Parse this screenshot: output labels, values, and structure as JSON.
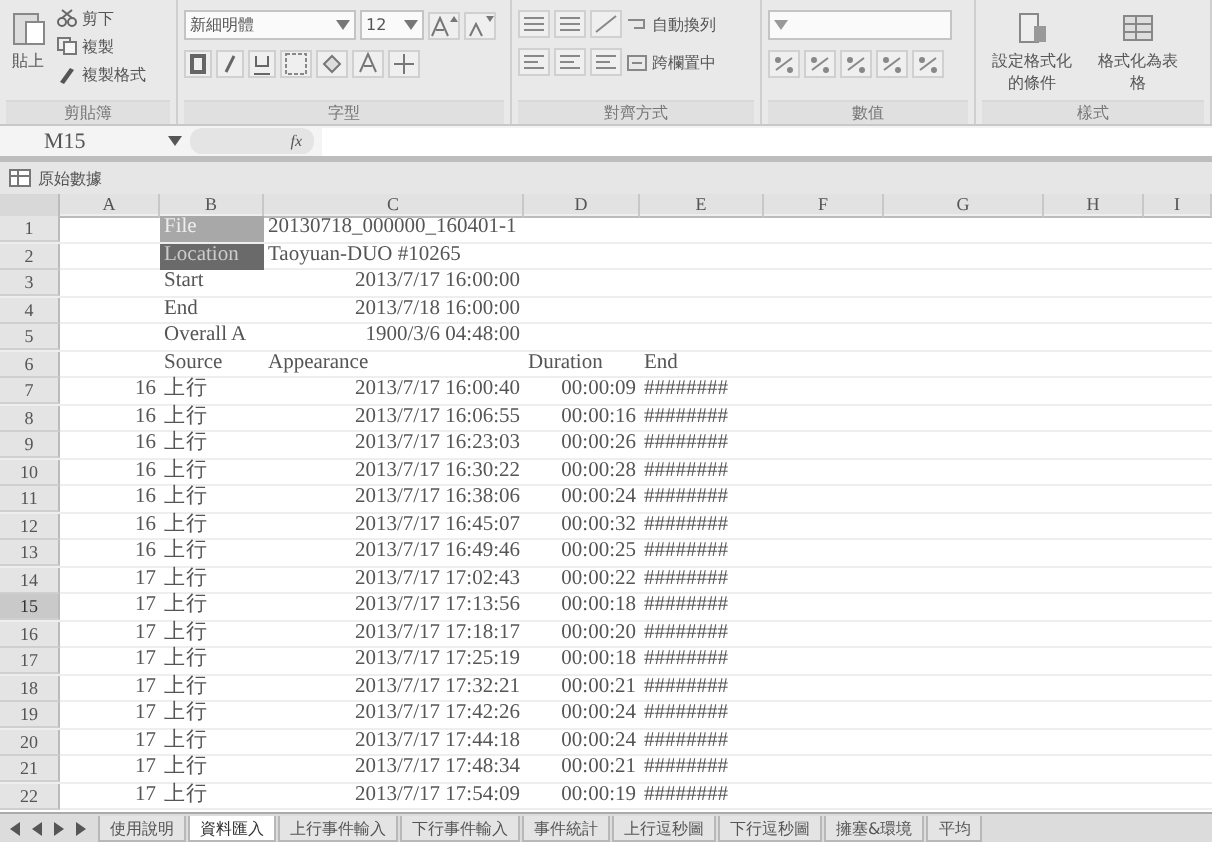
{
  "ribbon": {
    "groups": [
      {
        "kind": "clipboard",
        "label": "剪貼簿",
        "big": "貼上",
        "items": [
          "剪下",
          "複製",
          "複製格式"
        ]
      },
      {
        "kind": "font",
        "label": "字型",
        "font": "新細明體",
        "size": "12"
      },
      {
        "kind": "align",
        "label": "對齊方式",
        "items": [
          "自動換列",
          "跨欄置中"
        ]
      },
      {
        "kind": "number",
        "label": "數值"
      },
      {
        "kind": "styles",
        "label": "樣式",
        "items": [
          "設定格式化的條件",
          "格式化為表格"
        ]
      }
    ]
  },
  "formula_bar": {
    "name_box": "M15",
    "fx": "fx"
  },
  "workbook": {
    "title": "原始數據"
  },
  "columns": [
    "A",
    "B",
    "C",
    "D",
    "E",
    "F",
    "G",
    "H",
    "I"
  ],
  "rows": [
    {
      "number": "1",
      "selected": false,
      "kind": "info",
      "label_filled": true,
      "label_dark": false,
      "B": "File",
      "C": "20130718_000000_160401-1"
    },
    {
      "number": "2",
      "selected": false,
      "kind": "info",
      "label_filled": true,
      "label_dark": true,
      "B": "Location",
      "C": "Taoyuan-DUO #10265"
    },
    {
      "number": "3",
      "selected": false,
      "kind": "meta",
      "B": "Start",
      "C": "2013/7/17 16:00:00"
    },
    {
      "number": "4",
      "selected": false,
      "kind": "meta",
      "B": "End",
      "C": "2013/7/18 16:00:00"
    },
    {
      "number": "5",
      "selected": false,
      "kind": "meta",
      "B": "Overall A",
      "C": "1900/3/6 04:48:00"
    },
    {
      "number": "6",
      "selected": false,
      "kind": "header",
      "B": "Source",
      "C": "Appearance",
      "D": "Duration",
      "E": "End"
    },
    {
      "number": "7",
      "selected": false,
      "kind": "data",
      "A": "16",
      "B": "上行",
      "C": "2013/7/17 16:00:40",
      "D": "00:00:09",
      "E": "########"
    },
    {
      "number": "8",
      "selected": false,
      "kind": "data",
      "A": "16",
      "B": "上行",
      "C": "2013/7/17 16:06:55",
      "D": "00:00:16",
      "E": "########"
    },
    {
      "number": "9",
      "selected": false,
      "kind": "data",
      "A": "16",
      "B": "上行",
      "C": "2013/7/17 16:23:03",
      "D": "00:00:26",
      "E": "########"
    },
    {
      "number": "10",
      "selected": false,
      "kind": "data",
      "A": "16",
      "B": "上行",
      "C": "2013/7/17 16:30:22",
      "D": "00:00:28",
      "E": "########"
    },
    {
      "number": "11",
      "selected": false,
      "kind": "data",
      "A": "16",
      "B": "上行",
      "C": "2013/7/17 16:38:06",
      "D": "00:00:24",
      "E": "########"
    },
    {
      "number": "12",
      "selected": false,
      "kind": "data",
      "A": "16",
      "B": "上行",
      "C": "2013/7/17 16:45:07",
      "D": "00:00:32",
      "E": "########"
    },
    {
      "number": "13",
      "selected": false,
      "kind": "data",
      "A": "16",
      "B": "上行",
      "C": "2013/7/17 16:49:46",
      "D": "00:00:25",
      "E": "########"
    },
    {
      "number": "14",
      "selected": false,
      "kind": "data",
      "A": "17",
      "B": "上行",
      "C": "2013/7/17 17:02:43",
      "D": "00:00:22",
      "E": "########"
    },
    {
      "number": "15",
      "selected": true,
      "kind": "data",
      "A": "17",
      "B": "上行",
      "C": "2013/7/17 17:13:56",
      "D": "00:00:18",
      "E": "########"
    },
    {
      "number": "16",
      "selected": false,
      "kind": "data",
      "A": "17",
      "B": "上行",
      "C": "2013/7/17 17:18:17",
      "D": "00:00:20",
      "E": "########"
    },
    {
      "number": "17",
      "selected": false,
      "kind": "data",
      "A": "17",
      "B": "上行",
      "C": "2013/7/17 17:25:19",
      "D": "00:00:18",
      "E": "########"
    },
    {
      "number": "18",
      "selected": false,
      "kind": "data",
      "A": "17",
      "B": "上行",
      "C": "2013/7/17 17:32:21",
      "D": "00:00:21",
      "E": "########"
    },
    {
      "number": "19",
      "selected": false,
      "kind": "data",
      "A": "17",
      "B": "上行",
      "C": "2013/7/17 17:42:26",
      "D": "00:00:24",
      "E": "########"
    },
    {
      "number": "20",
      "selected": false,
      "kind": "data",
      "A": "17",
      "B": "上行",
      "C": "2013/7/17 17:44:18",
      "D": "00:00:24",
      "E": "########"
    },
    {
      "number": "21",
      "selected": false,
      "kind": "data",
      "A": "17",
      "B": "上行",
      "C": "2013/7/17 17:48:34",
      "D": "00:00:21",
      "E": "########"
    },
    {
      "number": "22",
      "selected": false,
      "kind": "data",
      "A": "17",
      "B": "上行",
      "C": "2013/7/17 17:54:09",
      "D": "00:00:19",
      "E": "########"
    }
  ],
  "sheet_tabs": [
    {
      "label": "使用說明",
      "selected": false
    },
    {
      "label": "資料匯入",
      "selected": true
    },
    {
      "label": "上行事件輸入",
      "selected": false
    },
    {
      "label": "下行事件輸入",
      "selected": false
    },
    {
      "label": "事件統計",
      "selected": false
    },
    {
      "label": "上行逗秒圖",
      "selected": false
    },
    {
      "label": "下行逗秒圖",
      "selected": false
    },
    {
      "label": "擁塞&環境",
      "selected": false
    },
    {
      "label": "平均",
      "selected": false
    }
  ]
}
